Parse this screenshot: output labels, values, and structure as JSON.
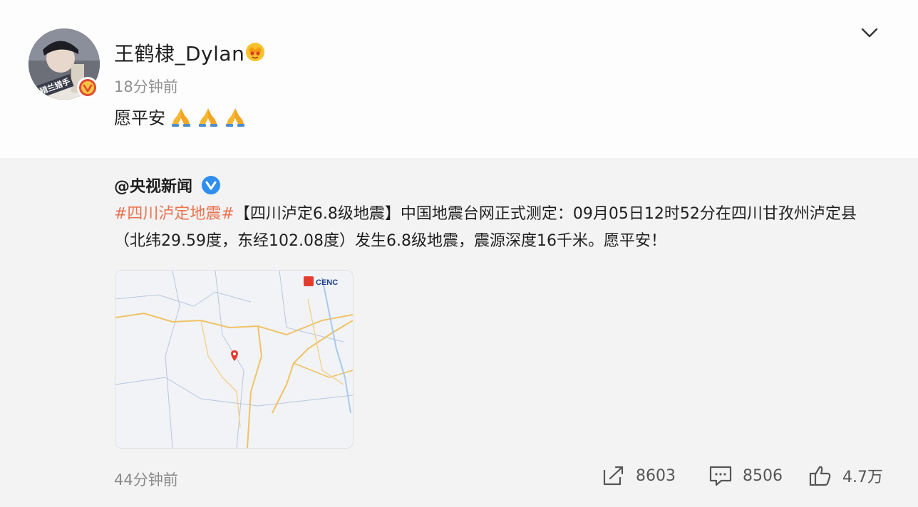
{
  "post": {
    "username": "王鹤棣_Dylan",
    "time": "18分钟前",
    "text": "愿平安",
    "emojis": [
      "pray-emoji",
      "pray-emoji",
      "pray-emoji"
    ],
    "avatar_badge_text": "猎兰猎手"
  },
  "repost": {
    "source": "@央视新闻",
    "hashtag": "#四川泸定地震#",
    "content": "【四川泸定6.8级地震】中国地震台网正式测定：09月05日12时52分在四川甘孜州泸定县（北纬29.59度，东经102.08度）发生6.8级地震，震源深度16千米。愿平安！",
    "map_logo_text": "CENC",
    "time": "44分钟前",
    "reposts": "8603",
    "comments": "8506",
    "likes": "4.7万"
  },
  "colors": {
    "hashtag": "#eb7350",
    "verified_blue": "#2f8ef0",
    "verified_orange": "#f78e1e",
    "background_repost": "#f3f3f3"
  },
  "icons": [
    "chevron-down-icon",
    "crown-icon",
    "verified-icon",
    "share-icon",
    "comment-icon",
    "like-icon",
    "map-pin-icon"
  ]
}
